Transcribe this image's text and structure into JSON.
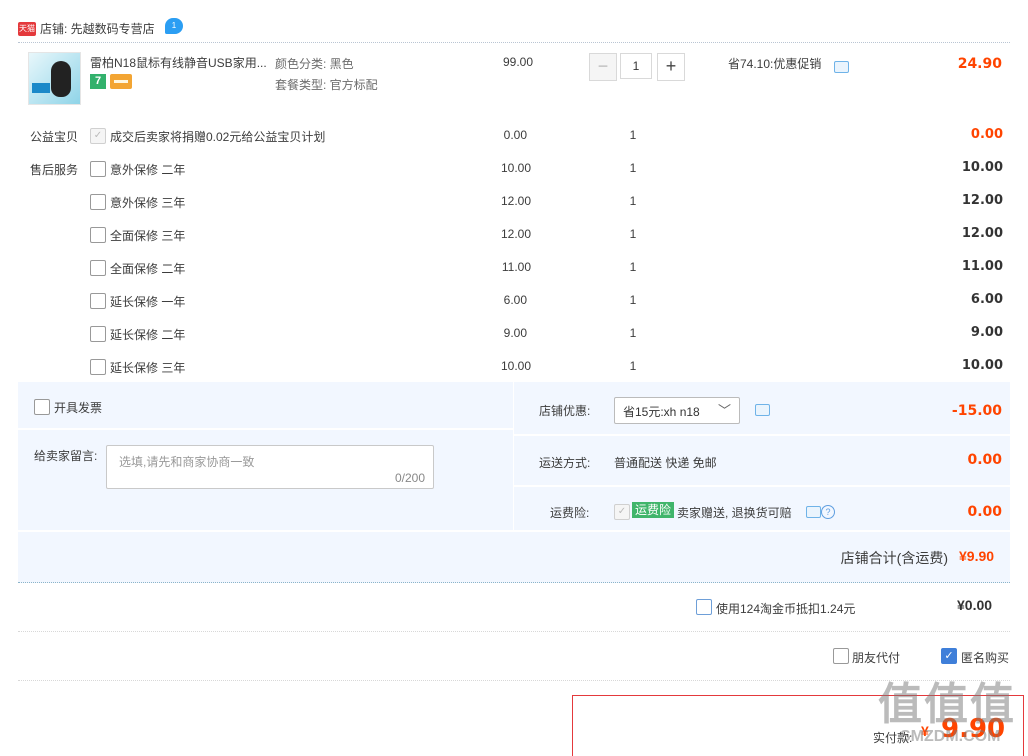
{
  "shop": {
    "label": "店铺: 先越数码专营店",
    "badge": "天猫",
    "chat_count": "1"
  },
  "product": {
    "title": "雷柏N18鼠标有线静音USB家用...",
    "badge7": "7",
    "sku_color": "颜色分类: 黑色",
    "sku_package": "套餐类型: 官方标配",
    "unit_price": "99.00",
    "quantity": "1",
    "qty_minus": "−",
    "qty_plus": "+",
    "discount_text": "省74.10:优惠促销",
    "subtotal": "24.90"
  },
  "charity": {
    "label": "公益宝贝",
    "text": "成交后卖家将捐赠0.02元给公益宝贝计划",
    "price": "0.00",
    "qty": "1",
    "total": "0.00"
  },
  "services_label": "售后服务",
  "services": [
    {
      "name": "意外保修  二年",
      "price": "10.00",
      "qty": "1",
      "total": "10.00"
    },
    {
      "name": "意外保修  三年",
      "price": "12.00",
      "qty": "1",
      "total": "12.00"
    },
    {
      "name": "全面保修  三年",
      "price": "12.00",
      "qty": "1",
      "total": "12.00"
    },
    {
      "name": "全面保修  二年",
      "price": "11.00",
      "qty": "1",
      "total": "11.00"
    },
    {
      "name": "延长保修  一年",
      "price": "6.00",
      "qty": "1",
      "total": "6.00"
    },
    {
      "name": "延长保修  二年",
      "price": "9.00",
      "qty": "1",
      "total": "9.00"
    },
    {
      "name": "延长保修  三年",
      "price": "10.00",
      "qty": "1",
      "total": "10.00"
    }
  ],
  "invoice": {
    "label": "开具发票"
  },
  "message": {
    "label": "给卖家留言:",
    "placeholder": "选填,请先和商家协商一致",
    "counter": "0/200"
  },
  "coupon": {
    "label": "店铺优惠:",
    "selected": "省15元:xh n18",
    "value": "-15.00"
  },
  "shipping": {
    "label": "运送方式:",
    "method": "普通配送 快递 免邮",
    "value": "0.00"
  },
  "freight_insurance": {
    "label": "运费险:",
    "tag": "运费险",
    "text": "卖家赠送, 退换货可赔",
    "value": "0.00"
  },
  "shop_total": {
    "label": "店铺合计(含运费)",
    "value": "¥9.90"
  },
  "coins": {
    "label": "使用124淘金币抵扣1.24元",
    "value": "¥0.00"
  },
  "friend_pay": {
    "label": "朋友代付"
  },
  "anonymous": {
    "label": "匿名购买"
  },
  "final": {
    "label": "实付款:",
    "value": "9.90",
    "currency": "¥"
  },
  "watermark": {
    "main": "值值值",
    "site": "SMZDM.COM"
  },
  "colors": {
    "accent_red": "#ff4400",
    "panel_bg": "#f2f7ff",
    "check_blue": "#3f7fd9",
    "tmall_red": "#e4393c"
  }
}
